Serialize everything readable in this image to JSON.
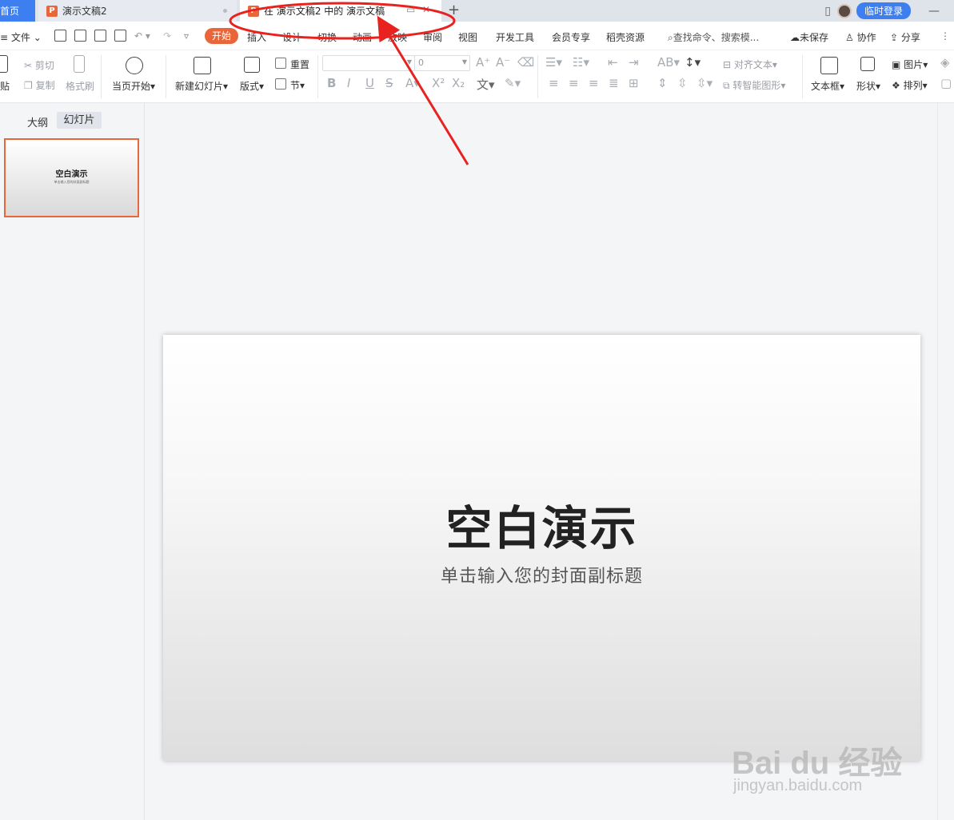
{
  "tabs": {
    "home": "首页",
    "doc2": "演示文稿2",
    "active": "在 演示文稿2 中的 演示文稿",
    "new_tab": "+"
  },
  "window": {
    "login_label": "临时登录"
  },
  "menu": {
    "file": "文件",
    "items": [
      "开始",
      "插入",
      "设计",
      "切换",
      "动画",
      "放映",
      "审阅",
      "视图",
      "开发工具",
      "会员专享",
      "稻壳资源"
    ],
    "search_placeholder": "查找命令、搜索模...",
    "unsaved": "未保存",
    "collaborate": "协作",
    "share": "分享"
  },
  "ribbon": {
    "paste": "贴",
    "cut": "剪切",
    "copy": "复制",
    "format_painter": "格式刷",
    "play_from_current": "当页开始",
    "new_slide": "新建幻灯片",
    "layout": "版式",
    "reset": "重置",
    "section": "节",
    "font_size_value": "0",
    "align_text": "对齐文本",
    "smart_shape": "转智能图形",
    "textbox": "文本框",
    "shape": "形状",
    "picture": "图片",
    "arrange": "排列"
  },
  "left_panel": {
    "outline_tab": "大纲",
    "slides_tab": "幻灯片",
    "thumb_title": "空白演示",
    "thumb_sub": "单击输入您的封面副标题"
  },
  "slide": {
    "title": "空白演示",
    "subtitle": "单击输入您的封面副标题"
  },
  "watermark": {
    "logo": "Bai du 经验",
    "url": "jingyan.baidu.com"
  },
  "colors": {
    "accent": "#e9663a",
    "blue": "#3d7ef0",
    "annotation": "#e8231f"
  }
}
